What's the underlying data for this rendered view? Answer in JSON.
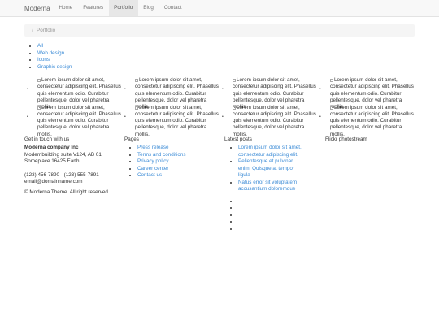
{
  "nav": {
    "brand": "Moderna",
    "items": [
      "Home",
      "Features",
      "Portfolio",
      "Blog",
      "Contact"
    ],
    "active_index": 2
  },
  "breadcrumb": {
    "separator": "/",
    "current": "Portfolio"
  },
  "filters": [
    "All",
    "Web design",
    "Icons",
    "Graphic design"
  ],
  "portfolio_alt": "Lorem ipsum dolor sit amet, consectetur adipiscing elit. Phasellus quis elementum odio. Curabitur pellentesque, dolor vel pharetra mollis.",
  "footer": {
    "contact": {
      "title": "Get in touch with us",
      "company": "Moderna company Inc",
      "address1": "Modernbuilding suite V124, AB 01",
      "address2": "Someplace 16425 Earth",
      "phone": "(123) 456-7890 - (123) 555-7891",
      "email": "email@domainname.com",
      "copyright": "© Moderna Theme. All right reserved."
    },
    "pages": {
      "title": "Pages",
      "links": [
        "Press release",
        "Terms and conditions",
        "Privacy policy",
        "Career center",
        "Contact us"
      ]
    },
    "latest": {
      "title": "Latest posts",
      "posts": [
        "Lorem ipsum dolor sit amet, consectetur adipiscing elit.",
        "Pellentesque et pulvinar enim. Quisque at tempor ligula",
        "Natus error sit voluptatem accusantium doloremque"
      ]
    },
    "flickr": {
      "title": "Flickr photostream"
    }
  },
  "colors": {
    "link": "#3b8bd6",
    "nav_bg": "#f8f8f8",
    "active_bg": "#e7e7e7",
    "breadcrumb_bg": "#f5f5f5"
  }
}
